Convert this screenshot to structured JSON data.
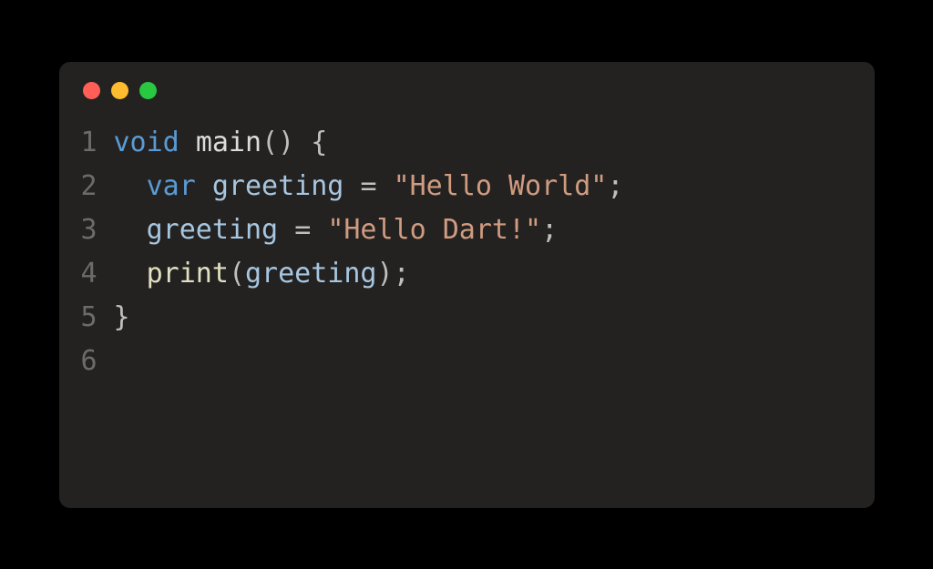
{
  "traffic_lights": {
    "close_color": "#ff5f57",
    "minimize_color": "#febc2e",
    "zoom_color": "#28c840"
  },
  "code": {
    "line_count": 6,
    "lines": {
      "1": {
        "number": "1"
      },
      "2": {
        "number": "2"
      },
      "3": {
        "number": "3"
      },
      "4": {
        "number": "4"
      },
      "5": {
        "number": "5"
      },
      "6": {
        "number": "6"
      }
    },
    "tokens": {
      "l1_void": "void",
      "l1_sp1": " ",
      "l1_main": "main",
      "l1_paren": "()",
      "l1_sp2": " ",
      "l1_brace": "{",
      "l2_indent": "  ",
      "l2_var": "var",
      "l2_sp1": " ",
      "l2_greeting": "greeting",
      "l2_sp2": " ",
      "l2_eq": "=",
      "l2_sp3": " ",
      "l2_str": "\"Hello World\"",
      "l2_semi": ";",
      "l3_indent": "  ",
      "l3_greeting": "greeting",
      "l3_sp1": " ",
      "l3_eq": "=",
      "l3_sp2": " ",
      "l3_str": "\"Hello Dart!\"",
      "l3_semi": ";",
      "l4_indent": "  ",
      "l4_print": "print",
      "l4_open": "(",
      "l4_greeting": "greeting",
      "l4_close": ")",
      "l4_semi": ";",
      "l5_brace": "}"
    }
  }
}
